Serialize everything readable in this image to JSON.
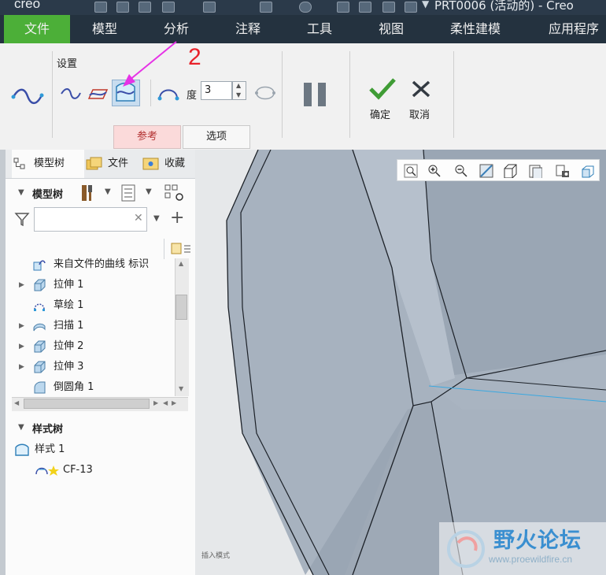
{
  "window": {
    "app_name": "creo",
    "title": "PRT0006 (活动的) - Creo"
  },
  "menu": {
    "items": [
      "文件",
      "模型",
      "分析",
      "注释",
      "工具",
      "视图",
      "柔性建模",
      "应用程序"
    ]
  },
  "ribbon": {
    "group_label": "设置",
    "degree_label": "度",
    "degree_value": "3",
    "ok_label": "确定",
    "cancel_label": "取消",
    "tabs": [
      "参考",
      "选项"
    ]
  },
  "annotation": {
    "number": "2",
    "color": "#e8222a",
    "arrow_color": "#e632e6"
  },
  "panel": {
    "tabs": [
      "模型树",
      "文件",
      "收藏"
    ],
    "tree_header": "模型树",
    "filter_placeholder": "",
    "tree_items": [
      {
        "label": "来自文件的曲线 标识",
        "icon": "curve-from-file-icon",
        "expandable": false
      },
      {
        "label": "拉伸 1",
        "icon": "extrude-icon",
        "expandable": true
      },
      {
        "label": "草绘 1",
        "icon": "sketch-icon",
        "expandable": false
      },
      {
        "label": "扫描 1",
        "icon": "sweep-icon",
        "expandable": true
      },
      {
        "label": "拉伸 2",
        "icon": "extrude-icon",
        "expandable": true
      },
      {
        "label": "拉伸 3",
        "icon": "extrude-icon",
        "expandable": true
      },
      {
        "label": "倒圆角 1",
        "icon": "round-icon",
        "expandable": false
      }
    ],
    "style_header": "样式树",
    "style_items": [
      {
        "label": "样式 1",
        "icon": "style-icon"
      },
      {
        "label": "CF-13",
        "icon": "curve-network-icon"
      }
    ]
  },
  "viewport": {
    "hint": "插入模式"
  },
  "watermark": {
    "text": "野火论坛",
    "url": "www.proewildfire.cn"
  },
  "colors": {
    "accent_green": "#4caf38",
    "menu_bg": "#24323f",
    "model_surface": "#9aa6b4"
  }
}
